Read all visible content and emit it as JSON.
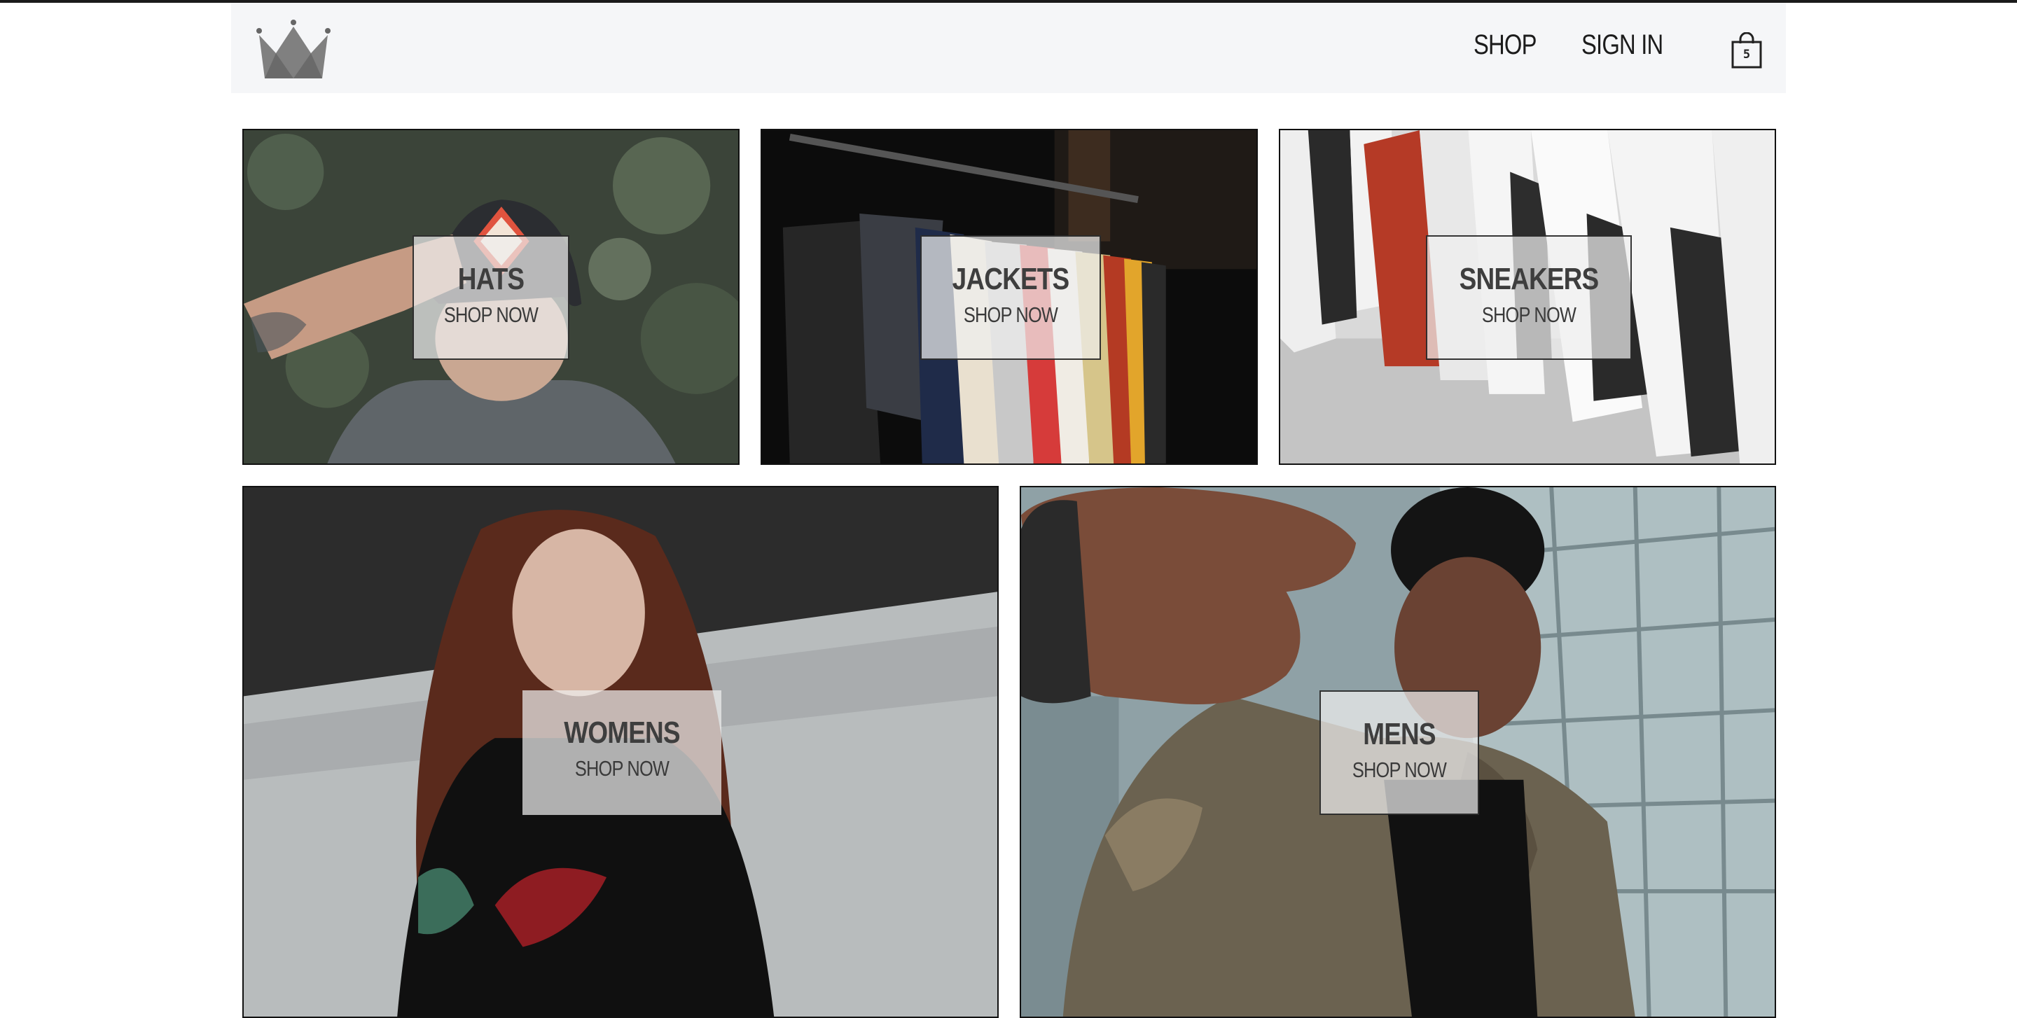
{
  "header": {
    "logo_icon": "crown-icon",
    "nav": {
      "shop_label": "SHOP",
      "signin_label": "SIGN IN"
    },
    "cart": {
      "icon": "shopping-bag-icon",
      "count": "5"
    }
  },
  "categories": [
    {
      "title": "HATS",
      "subtitle": "SHOP NOW",
      "image": "man-in-black-cap-photo"
    },
    {
      "title": "JACKETS",
      "subtitle": "SHOP NOW",
      "image": "jackets-on-rack-photo"
    },
    {
      "title": "SNEAKERS",
      "subtitle": "SHOP NOW",
      "image": "sneakers-on-shelf-photo"
    },
    {
      "title": "WOMENS",
      "subtitle": "SHOP NOW",
      "image": "woman-in-black-sweater-photo"
    },
    {
      "title": "MENS",
      "subtitle": "SHOP NOW",
      "image": "man-reaching-hand-photo"
    }
  ],
  "colors": {
    "header_bg": "#f5f6f8",
    "label_bg": "#eeeeee",
    "border": "#111111",
    "text": "#3e3e3e"
  }
}
